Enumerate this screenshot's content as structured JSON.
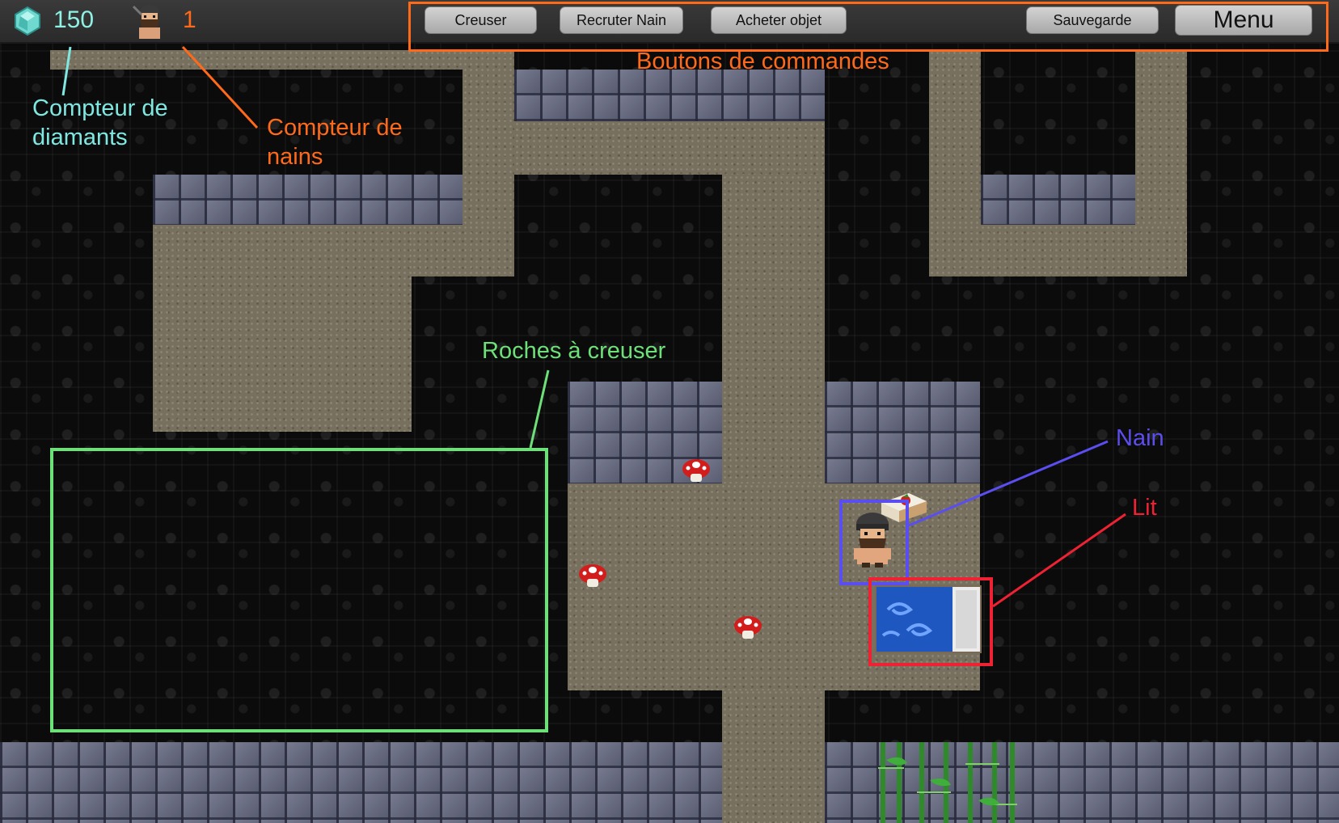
{
  "hud": {
    "diamond_count": "150",
    "dwarf_count": "1",
    "diamond_color": "#8ff0e4",
    "dwarf_count_color": "#ff6a1a"
  },
  "commands": {
    "dig": "Creuser",
    "recruit": "Recruter Nain",
    "buy": "Acheter objet",
    "save": "Sauvegarde",
    "menu": "Menu"
  },
  "annotations": {
    "command_buttons": "Boutons de commandes",
    "diamond_counter_line1": "Compteur de",
    "diamond_counter_line2": "diamants",
    "dwarf_counter_line1": "Compteur de",
    "dwarf_counter_line2": "nains",
    "rocks_to_dig": "Roches à creuser",
    "dwarf": "Nain",
    "bed": "Lit"
  },
  "colors": {
    "orange": "#ff6a1a",
    "cyan": "#7fe8e0",
    "green": "#6ee07a",
    "purple": "#5b4ef0",
    "red": "#ee2233"
  },
  "icons": [
    "diamond-icon",
    "dwarf-icon",
    "mushroom-icon",
    "bed-icon",
    "cake-icon",
    "bamboo-icon"
  ]
}
